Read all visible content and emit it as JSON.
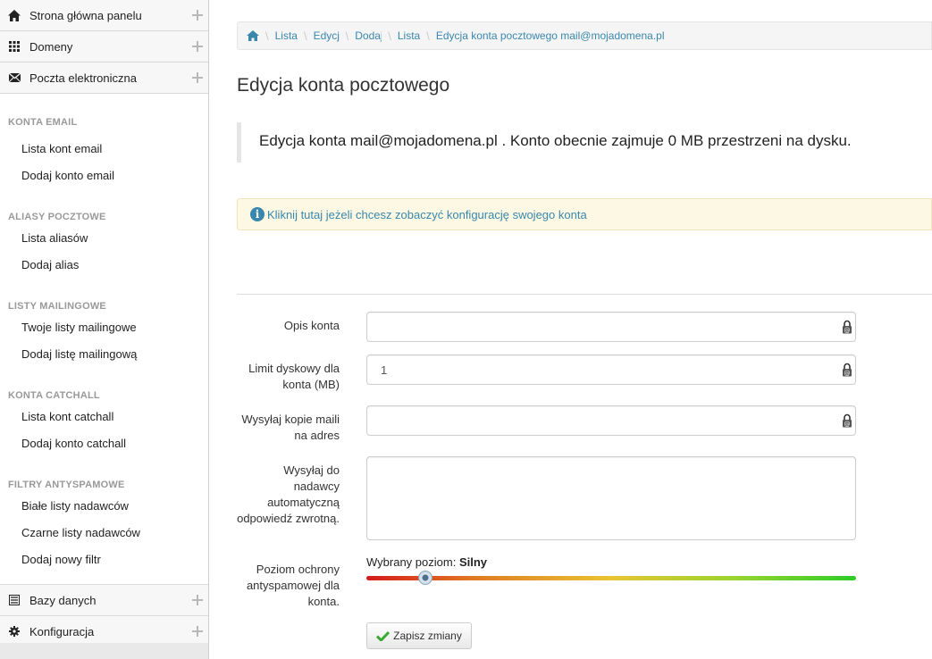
{
  "sidebar": {
    "top_items": [
      {
        "label": "Strona główna panelu",
        "icon": "home-icon"
      },
      {
        "label": "Domeny",
        "icon": "grid-icon"
      },
      {
        "label": "Poczta elektroniczna",
        "icon": "envelope-icon"
      }
    ],
    "sections": [
      {
        "header": "KONTA EMAIL",
        "links": [
          "Lista kont email",
          "Dodaj konto email"
        ]
      },
      {
        "header": "ALIASY POCZTOWE",
        "links": [
          "Lista aliasów",
          "Dodaj alias"
        ]
      },
      {
        "header": "LISTY MAILINGOWE",
        "links": [
          "Twoje listy mailingowe",
          "Dodaj listę mailingową"
        ]
      },
      {
        "header": "KONTA CATCHALL",
        "links": [
          "Lista kont catchall",
          "Dodaj konto catchall"
        ]
      },
      {
        "header": "FILTRY ANTYSPAMOWE",
        "links": [
          "Białe listy nadawców",
          "Czarne listy nadawców",
          "Dodaj nowy filtr"
        ]
      }
    ],
    "bottom_items": [
      {
        "label": "Bazy danych",
        "icon": "list-icon"
      },
      {
        "label": "Konfiguracja",
        "icon": "gear-icon"
      }
    ]
  },
  "breadcrumb": {
    "items": [
      "Lista",
      "Edycj",
      "Dodaj",
      "Lista",
      "Edycja konta pocztowego mail@mojadomena.pl"
    ]
  },
  "page_title": "Edycja konta pocztowego",
  "lead_text": "Edycja konta mail@mojadomena.pl . Konto obecnie zajmuje 0 MB przestrzeni na dysku.",
  "info": {
    "text": "Kliknij tutaj jeżeli chcesz zobaczyć konfigurację swojego konta",
    "icon": "info-icon"
  },
  "form": {
    "description_label": "Opis konta",
    "description_value": "",
    "limit_label": "Limit dyskowy dla konta (MB)",
    "limit_value": "1",
    "copy_label": "Wysyłaj kopie maili na adres",
    "copy_value": "",
    "autoreply_label": "Wysyłaj do nadawcy automatyczną odpowiedź zwrotną.",
    "autoreply_value": "",
    "spam_label": "Poziom ochrony antyspamowej dla konta.",
    "spam_prefix": "Wybrany poziom:",
    "spam_level": "Silny",
    "spam_slider_fraction": 0.12,
    "save_label": "Zapisz zmiany"
  },
  "colors": {
    "link": "#3a87ad",
    "info_bg": "#fcf8e3",
    "save_check": "#3aa933"
  }
}
